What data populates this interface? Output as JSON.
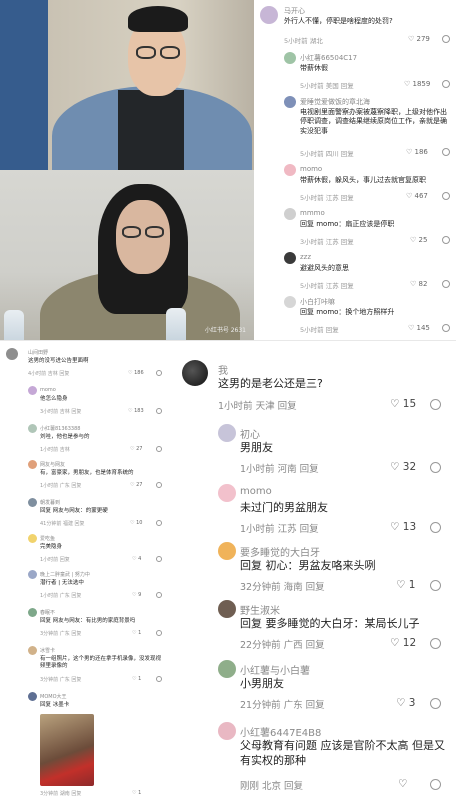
{
  "photos": {
    "top_watermark": "",
    "bottom_watermark": "小红书号 2631"
  },
  "right_panel": {
    "comments": [
      {
        "name": "马开心",
        "text": "外行人不懂，停职是啥程度的处罚?",
        "meta": "5小时前 湖北",
        "likes": "279"
      },
      {
        "name": "小红薯66504C17",
        "text": "带薪休假",
        "meta": "5小时前 美国 回复",
        "likes": "1859"
      },
      {
        "name": "爱睡觉爱做饭的章北海",
        "text": "电视剧里面警察办案被蔑察降职，上级对他作出停职调查，调查结果继续原岗位工作，亲就是确实没犯事",
        "meta": "5小时前 四川 回复",
        "likes": "186"
      },
      {
        "name": "momo",
        "text": "带薪休假，躲风头，事儿过去就官复原职",
        "meta": "5小时前 江苏 回复",
        "likes": "467"
      },
      {
        "name": "mmmo",
        "text": "回复 momo：扇正应该是停职",
        "meta": "3小时前 江苏 回复",
        "likes": "25"
      },
      {
        "name": "zzz",
        "text": "避避风头的意思",
        "meta": "5小时前 江苏 回复",
        "likes": "82"
      },
      {
        "name": "小白打咔嘛",
        "text": "回复 momo：换个地方照样升",
        "meta": "5小时前 回复",
        "likes": "145"
      }
    ]
  },
  "left_panel": {
    "comments": [
      {
        "name": "山间田野",
        "text": "这男的没写进公告里面啊",
        "meta": "4小时前 吉林 回复",
        "likes": "186"
      },
      {
        "name": "momo",
        "text": "他怎么隐身",
        "meta": "3小时前 吉林 回复",
        "likes": "183"
      },
      {
        "name": "小红薯81363388",
        "text": "刘哇，他也是参与的",
        "meta": "1小时前 吉林",
        "likes": "27"
      },
      {
        "name": "网友与网友",
        "text": "有，富豪家，男朋友，也是体育系统的",
        "meta": "1小时前 广东 回复",
        "likes": "27"
      },
      {
        "name": "朝发暮到",
        "text": "回复 网友与网友：的蒙更硬",
        "meta": "41分钟前 福建 回复",
        "likes": "10"
      },
      {
        "name": "爱吃鱼",
        "text": "完美隐身",
        "meta": "1小时前 回复",
        "likes": "4"
      },
      {
        "name": "晚上二胖童武 | 努力中",
        "text": "潜行者 | 无法选中",
        "meta": "1小时前 广东 回复",
        "likes": "9"
      },
      {
        "name": "春眠不",
        "text": "回复 网友与网友：有比男的家庭背景吗",
        "meta": "3分钟前 广东 回复",
        "likes": "1"
      },
      {
        "name": "冰雪卡",
        "text": "有一组照片，这个男的还在拿手机录像，没发现视频里录像的",
        "meta": "3分钟前 广东 回复",
        "likes": "1"
      },
      {
        "name": "MOMO大王",
        "text": "回复 冰墨卡",
        "meta": "3分钟前 湖南 回复",
        "likes": "1"
      }
    ]
  },
  "main_panel": {
    "comments": [
      {
        "name": "我",
        "text": "这男的是老公还是三?",
        "meta": "1小时前 天津  回复",
        "likes": "15"
      },
      {
        "name": "初心",
        "text": "男朋友",
        "meta": "1小时前 河南  回复",
        "likes": "32"
      },
      {
        "name": "momo",
        "text": "未过门的男盆朋友",
        "meta": "1小时前 江苏  回复",
        "likes": "13"
      },
      {
        "name": "要多睡觉的大白牙",
        "text": "回复  初心：男盆友咯来头咧",
        "meta": "32分钟前 海南  回复",
        "likes": "1"
      },
      {
        "name": "野生淑米",
        "text": "回复  要多睡觉的大白牙：某局长儿子",
        "meta": "22分钟前 广西  回复",
        "likes": "12"
      },
      {
        "name": "小红薯与小白薯",
        "text": "小男朋友",
        "meta": "21分钟前 广东  回复",
        "likes": "3"
      },
      {
        "name": "小红薯6447E4B8",
        "text": "父母教育有问题 应该是官阶不太高 但是又有实权的那种",
        "meta": "刚刚 北京  回复",
        "likes": ""
      }
    ]
  },
  "colors": {
    "heart": "#555555",
    "name_gray": "#8a8a8a",
    "meta_gray": "#999999"
  }
}
